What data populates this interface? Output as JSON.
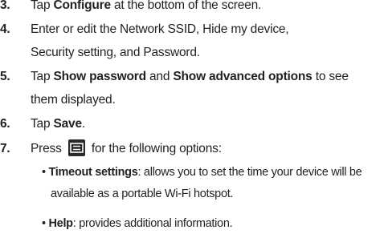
{
  "steps": [
    {
      "number": "3.",
      "parts": [
        "Tap ",
        "Configure",
        " at the bottom of the screen."
      ]
    },
    {
      "number": "4.",
      "line1": "Enter or edit the Network SSID, Hide my device,",
      "line2": "Security setting, and Password."
    },
    {
      "number": "5.",
      "parts": [
        "Tap ",
        "Show password",
        " and ",
        "Show advanced options",
        " to see"
      ],
      "line2": "them displayed."
    },
    {
      "number": "6.",
      "parts": [
        "Tap ",
        "Save",
        "."
      ]
    },
    {
      "number": "7.",
      "parts": [
        "Press ",
        " for the following options:"
      ],
      "icon": "menu-key-icon"
    }
  ],
  "bullets": [
    {
      "marker": "•",
      "term": "Timeout settings",
      "text1": ": allows you to set the time your device will be",
      "text2": "available as a portable Wi-Fi hotspot."
    },
    {
      "marker": "•",
      "term": "Help",
      "text1": ": provides additional information."
    }
  ]
}
